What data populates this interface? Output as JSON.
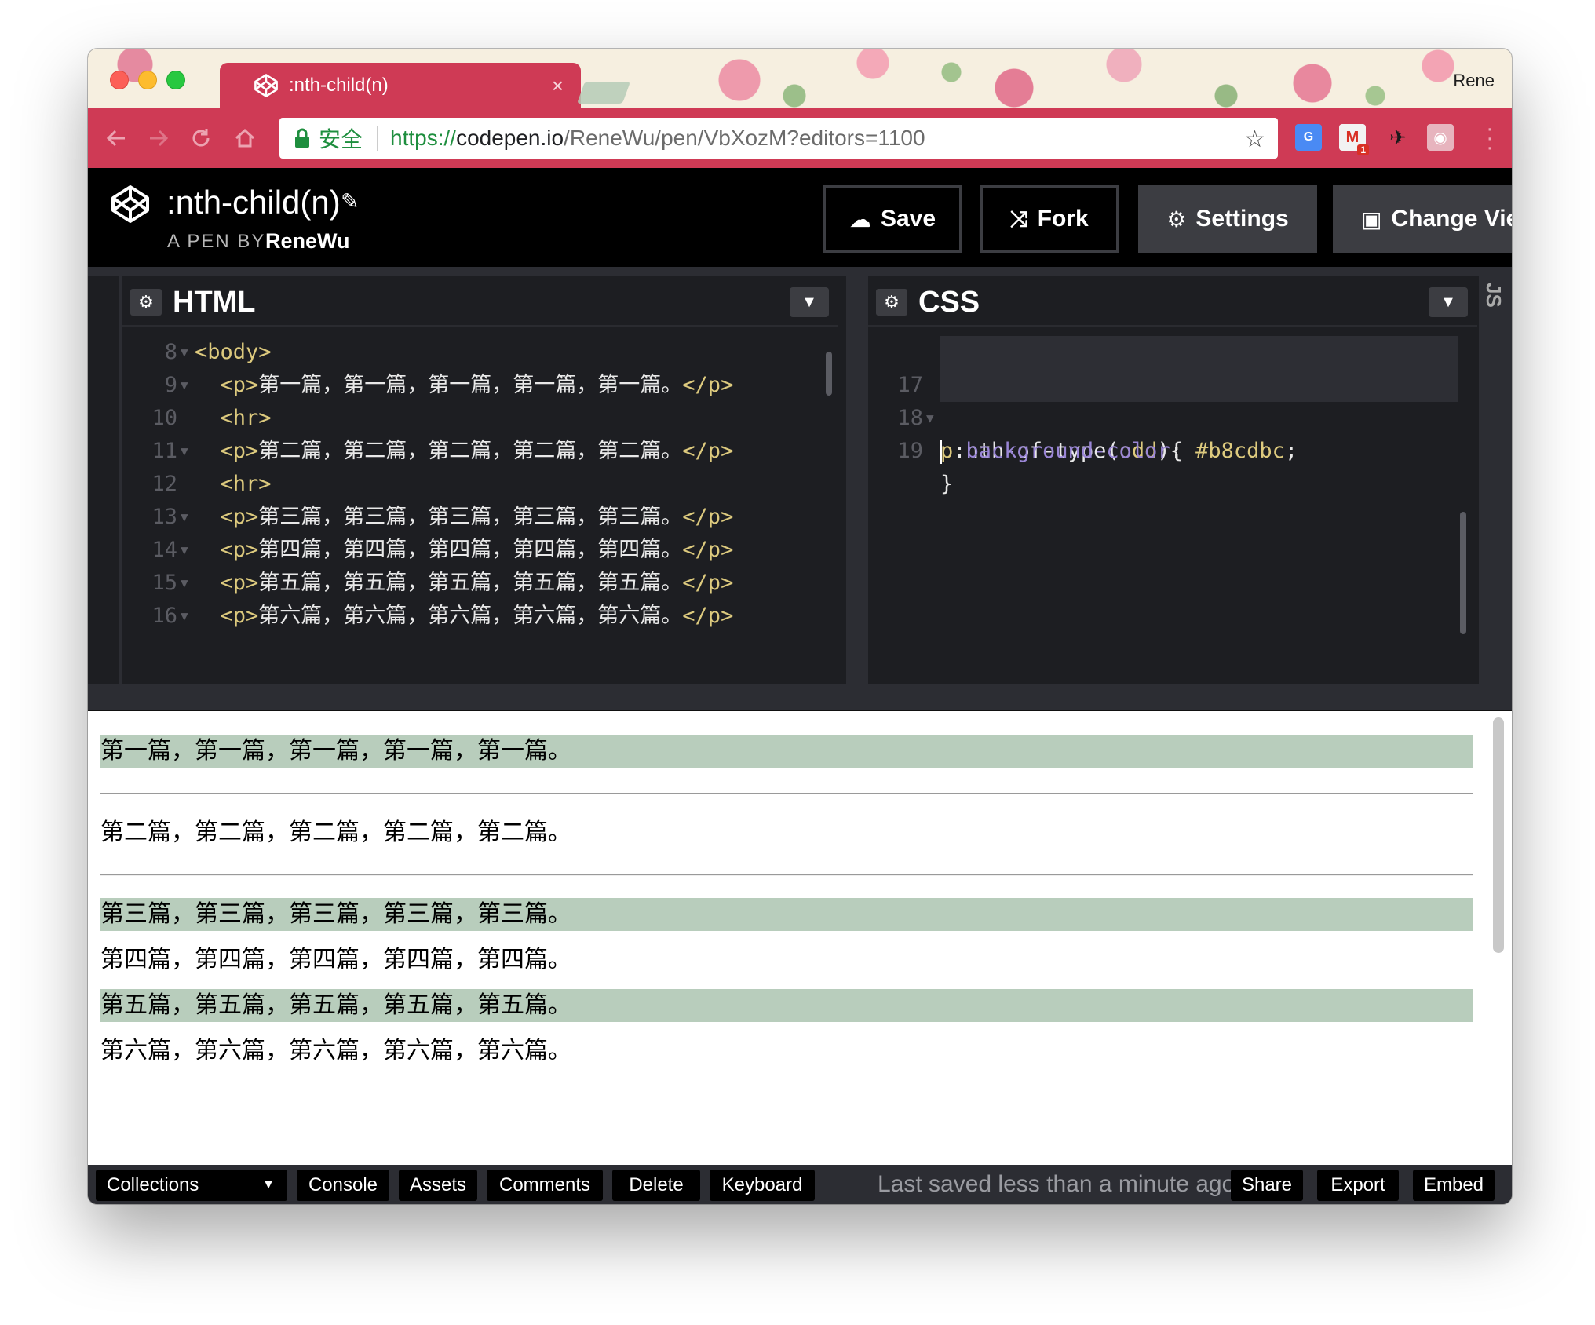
{
  "browser": {
    "tab_title": ":nth-child(n)",
    "tab_close": "×",
    "profile_name": "Rene",
    "secure_label": "安全",
    "url_scheme": "https://",
    "url_host": "codepen.io",
    "url_path": "/ReneWu/pen/VbXozM?editors=1100",
    "gmail_badge": "1"
  },
  "header": {
    "pen_title": ":nth-child(n)",
    "pen_by": "A PEN BY",
    "author": "ReneWu",
    "buttons": {
      "save": "Save",
      "fork": "Fork",
      "settings": "Settings",
      "change_view": "Change View"
    }
  },
  "html_editor": {
    "title": "HTML",
    "lines": [
      {
        "n": "8",
        "fold": true,
        "indent": "",
        "open": "<body>",
        "text": "",
        "close": ""
      },
      {
        "n": "9",
        "fold": true,
        "indent": "  ",
        "open": "<p>",
        "text": "第一篇，第一篇，第一篇，第一篇，第一篇。",
        "close": "</p>"
      },
      {
        "n": "10",
        "fold": false,
        "indent": "  ",
        "open": "<hr>",
        "text": "",
        "close": ""
      },
      {
        "n": "11",
        "fold": true,
        "indent": "  ",
        "open": "<p>",
        "text": "第二篇，第二篇，第二篇，第二篇，第二篇。",
        "close": "</p>"
      },
      {
        "n": "12",
        "fold": false,
        "indent": "  ",
        "open": "<hr>",
        "text": "",
        "close": ""
      },
      {
        "n": "13",
        "fold": true,
        "indent": "  ",
        "open": "<p>",
        "text": "第三篇，第三篇，第三篇，第三篇，第三篇。",
        "close": "</p>"
      },
      {
        "n": "14",
        "fold": true,
        "indent": "  ",
        "open": "<p>",
        "text": "第四篇，第四篇，第四篇，第四篇，第四篇。",
        "close": "</p>"
      },
      {
        "n": "15",
        "fold": true,
        "indent": "  ",
        "open": "<p>",
        "text": "第五篇，第五篇，第五篇，第五篇，第五篇。",
        "close": "</p>"
      },
      {
        "n": "16",
        "fold": true,
        "indent": "  ",
        "open": "<p>",
        "text": "第六篇，第六篇，第六篇，第六篇，第六篇。",
        "close": "</p>"
      }
    ]
  },
  "css_editor": {
    "title": "CSS",
    "lines": [
      {
        "n": "17",
        "selector_first": "p",
        "selector_rest": ":nth-of-type(",
        "arg": "odd",
        "tail": "){"
      },
      {
        "n": "18",
        "property": "background-color",
        "colon": ": ",
        "value": "#b8cdbc",
        "semi": ";"
      },
      {
        "n": "19",
        "brace": "}"
      }
    ]
  },
  "js_tab_label": "JS",
  "result": {
    "odd_bg": "#b8cdbc",
    "items": [
      {
        "text": "第一篇，第一篇，第一篇，第一篇，第一篇。",
        "odd": true,
        "hr_after": true
      },
      {
        "text": "第二篇，第二篇，第二篇，第二篇，第二篇。",
        "odd": false,
        "hr_after": true
      },
      {
        "text": "第三篇，第三篇，第三篇，第三篇，第三篇。",
        "odd": true,
        "hr_after": false
      },
      {
        "text": "第四篇，第四篇，第四篇，第四篇，第四篇。",
        "odd": false,
        "hr_after": false
      },
      {
        "text": "第五篇，第五篇，第五篇，第五篇，第五篇。",
        "odd": true,
        "hr_after": false
      },
      {
        "text": "第六篇，第六篇，第六篇，第六篇，第六篇。",
        "odd": false,
        "hr_after": false
      }
    ]
  },
  "footer": {
    "collections": "Collections",
    "console": "Console",
    "assets": "Assets",
    "comments": "Comments",
    "delete": "Delete",
    "keyboard": "Keyboard",
    "status": "Last saved less than a minute ago",
    "share": "Share",
    "export": "Export",
    "embed": "Embed"
  },
  "colors": {
    "chrome_accent": "#cf3a55",
    "codepen_header": "#000000",
    "editor_bg": "#1d1e22",
    "tag_color": "#ddca7e",
    "property_color": "#9a86d6"
  }
}
